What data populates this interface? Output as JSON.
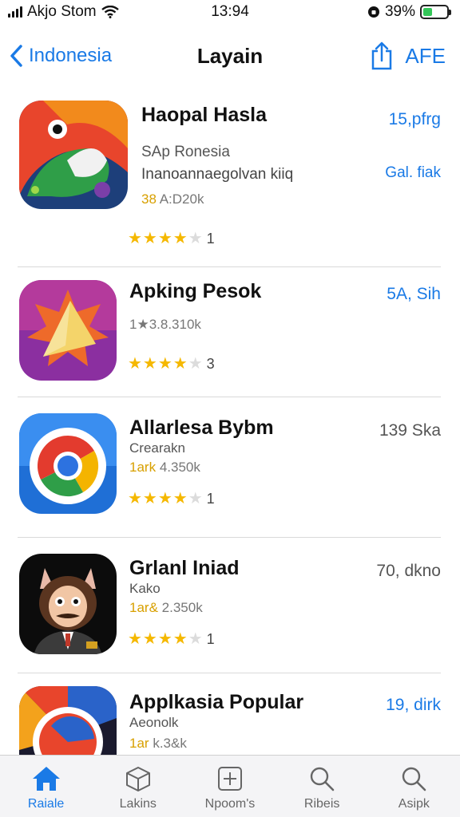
{
  "status_bar": {
    "carrier": "Akjo Stom",
    "time": "13:94",
    "battery": "39%",
    "battery_level": 0.39,
    "battery_color": "#34c759"
  },
  "nav": {
    "back_label": "Indonesia",
    "title": "Layain",
    "right_label": "AFE",
    "accent": "#1a7ae6"
  },
  "apps": [
    {
      "name": "Haopal Hasla",
      "subtitle": "SAp Ronesia",
      "description": "Inanoannaegolvan kiiq",
      "meta_hl": "38",
      "meta": "A:D20k",
      "stars": "★★★★",
      "star_empty": "★",
      "rating_count": "1",
      "price": "15,pfrg",
      "action": "Gal. fiak",
      "icon": "parrot-app-icon"
    },
    {
      "name": "Apking Pesok",
      "meta": "1★3.8.310k",
      "stars": "★★★★",
      "star_empty": "★",
      "rating_count": "3",
      "price": "5A, Sih",
      "icon": "paper-plane-app-icon"
    },
    {
      "name": "Allarlesa Bybm",
      "subtitle": "Crearakn",
      "meta_hl": "1ark",
      "meta": "4.350k",
      "stars": "★★★★",
      "star_empty": "★",
      "rating_count": "1",
      "price": "139 Ska",
      "icon": "chrome-like-app-icon"
    },
    {
      "name": "Grlanl Iniad",
      "subtitle": "Kako",
      "meta_hl": "1ar&",
      "meta": "2.350k",
      "stars": "★★★★",
      "star_empty": "★",
      "rating_count": "1",
      "price": "70, dkno",
      "icon": "cat-man-app-icon"
    },
    {
      "name": "Applkasia Popular",
      "subtitle": "Aeonolk",
      "meta_hl": "1ar",
      "meta": "k.3&k",
      "price": "19, dirk",
      "icon": "colorful-circle-app-icon"
    }
  ],
  "tabs": [
    {
      "label": "Raiale",
      "icon": "home-icon",
      "active": true
    },
    {
      "label": "Lakins",
      "icon": "box-icon",
      "active": false
    },
    {
      "label": "Npoom's",
      "icon": "add-square-icon",
      "active": false
    },
    {
      "label": "Ribeis",
      "icon": "search-icon",
      "active": false
    },
    {
      "label": "Asipk",
      "icon": "search-icon",
      "active": false
    }
  ]
}
